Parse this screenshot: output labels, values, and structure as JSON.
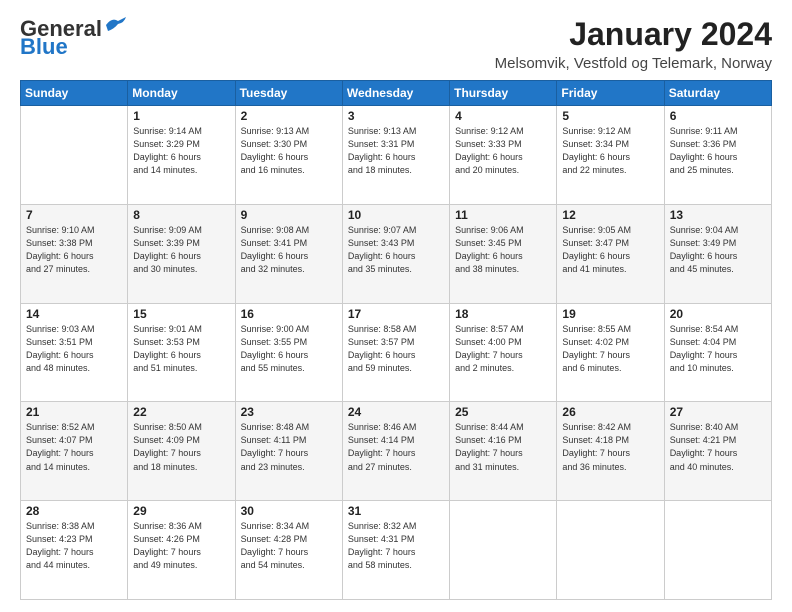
{
  "logo": {
    "general": "General",
    "blue": "Blue"
  },
  "title": "January 2024",
  "location": "Melsomvik, Vestfold og Telemark, Norway",
  "days_header": [
    "Sunday",
    "Monday",
    "Tuesday",
    "Wednesday",
    "Thursday",
    "Friday",
    "Saturday"
  ],
  "weeks": [
    [
      {
        "day": "",
        "info": ""
      },
      {
        "day": "1",
        "info": "Sunrise: 9:14 AM\nSunset: 3:29 PM\nDaylight: 6 hours\nand 14 minutes."
      },
      {
        "day": "2",
        "info": "Sunrise: 9:13 AM\nSunset: 3:30 PM\nDaylight: 6 hours\nand 16 minutes."
      },
      {
        "day": "3",
        "info": "Sunrise: 9:13 AM\nSunset: 3:31 PM\nDaylight: 6 hours\nand 18 minutes."
      },
      {
        "day": "4",
        "info": "Sunrise: 9:12 AM\nSunset: 3:33 PM\nDaylight: 6 hours\nand 20 minutes."
      },
      {
        "day": "5",
        "info": "Sunrise: 9:12 AM\nSunset: 3:34 PM\nDaylight: 6 hours\nand 22 minutes."
      },
      {
        "day": "6",
        "info": "Sunrise: 9:11 AM\nSunset: 3:36 PM\nDaylight: 6 hours\nand 25 minutes."
      }
    ],
    [
      {
        "day": "7",
        "info": "Sunrise: 9:10 AM\nSunset: 3:38 PM\nDaylight: 6 hours\nand 27 minutes."
      },
      {
        "day": "8",
        "info": "Sunrise: 9:09 AM\nSunset: 3:39 PM\nDaylight: 6 hours\nand 30 minutes."
      },
      {
        "day": "9",
        "info": "Sunrise: 9:08 AM\nSunset: 3:41 PM\nDaylight: 6 hours\nand 32 minutes."
      },
      {
        "day": "10",
        "info": "Sunrise: 9:07 AM\nSunset: 3:43 PM\nDaylight: 6 hours\nand 35 minutes."
      },
      {
        "day": "11",
        "info": "Sunrise: 9:06 AM\nSunset: 3:45 PM\nDaylight: 6 hours\nand 38 minutes."
      },
      {
        "day": "12",
        "info": "Sunrise: 9:05 AM\nSunset: 3:47 PM\nDaylight: 6 hours\nand 41 minutes."
      },
      {
        "day": "13",
        "info": "Sunrise: 9:04 AM\nSunset: 3:49 PM\nDaylight: 6 hours\nand 45 minutes."
      }
    ],
    [
      {
        "day": "14",
        "info": "Sunrise: 9:03 AM\nSunset: 3:51 PM\nDaylight: 6 hours\nand 48 minutes."
      },
      {
        "day": "15",
        "info": "Sunrise: 9:01 AM\nSunset: 3:53 PM\nDaylight: 6 hours\nand 51 minutes."
      },
      {
        "day": "16",
        "info": "Sunrise: 9:00 AM\nSunset: 3:55 PM\nDaylight: 6 hours\nand 55 minutes."
      },
      {
        "day": "17",
        "info": "Sunrise: 8:58 AM\nSunset: 3:57 PM\nDaylight: 6 hours\nand 59 minutes."
      },
      {
        "day": "18",
        "info": "Sunrise: 8:57 AM\nSunset: 4:00 PM\nDaylight: 7 hours\nand 2 minutes."
      },
      {
        "day": "19",
        "info": "Sunrise: 8:55 AM\nSunset: 4:02 PM\nDaylight: 7 hours\nand 6 minutes."
      },
      {
        "day": "20",
        "info": "Sunrise: 8:54 AM\nSunset: 4:04 PM\nDaylight: 7 hours\nand 10 minutes."
      }
    ],
    [
      {
        "day": "21",
        "info": "Sunrise: 8:52 AM\nSunset: 4:07 PM\nDaylight: 7 hours\nand 14 minutes."
      },
      {
        "day": "22",
        "info": "Sunrise: 8:50 AM\nSunset: 4:09 PM\nDaylight: 7 hours\nand 18 minutes."
      },
      {
        "day": "23",
        "info": "Sunrise: 8:48 AM\nSunset: 4:11 PM\nDaylight: 7 hours\nand 23 minutes."
      },
      {
        "day": "24",
        "info": "Sunrise: 8:46 AM\nSunset: 4:14 PM\nDaylight: 7 hours\nand 27 minutes."
      },
      {
        "day": "25",
        "info": "Sunrise: 8:44 AM\nSunset: 4:16 PM\nDaylight: 7 hours\nand 31 minutes."
      },
      {
        "day": "26",
        "info": "Sunrise: 8:42 AM\nSunset: 4:18 PM\nDaylight: 7 hours\nand 36 minutes."
      },
      {
        "day": "27",
        "info": "Sunrise: 8:40 AM\nSunset: 4:21 PM\nDaylight: 7 hours\nand 40 minutes."
      }
    ],
    [
      {
        "day": "28",
        "info": "Sunrise: 8:38 AM\nSunset: 4:23 PM\nDaylight: 7 hours\nand 44 minutes."
      },
      {
        "day": "29",
        "info": "Sunrise: 8:36 AM\nSunset: 4:26 PM\nDaylight: 7 hours\nand 49 minutes."
      },
      {
        "day": "30",
        "info": "Sunrise: 8:34 AM\nSunset: 4:28 PM\nDaylight: 7 hours\nand 54 minutes."
      },
      {
        "day": "31",
        "info": "Sunrise: 8:32 AM\nSunset: 4:31 PM\nDaylight: 7 hours\nand 58 minutes."
      },
      {
        "day": "",
        "info": ""
      },
      {
        "day": "",
        "info": ""
      },
      {
        "day": "",
        "info": ""
      }
    ]
  ]
}
